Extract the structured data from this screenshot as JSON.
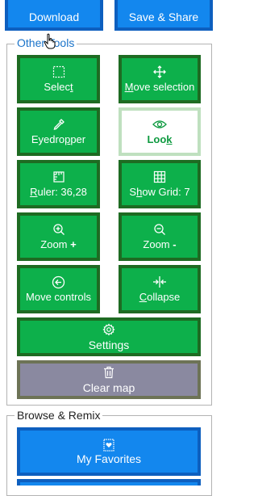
{
  "top": {
    "download_label": "Download",
    "save_share_label": "Save & Share"
  },
  "other_tools": {
    "legend": "Other Tools",
    "buttons": [
      {
        "pre": "Selec",
        "ul": "t",
        "post": ""
      },
      {
        "pre": "",
        "ul": "M",
        "post": "ove selection"
      },
      {
        "pre": "Eyedro",
        "ul": "p",
        "post": "per"
      },
      {
        "pre": "Loo",
        "ul": "k",
        "post": ""
      },
      {
        "pre": "",
        "ul": "R",
        "post": "uler: 36,28"
      },
      {
        "pre": "S",
        "ul": "h",
        "post": "ow Grid: 7"
      },
      {
        "pre": "Zoom ",
        "bold": "+",
        "post": ""
      },
      {
        "pre": "Zoom ",
        "bold": "-",
        "post": ""
      },
      {
        "pre": "Move controls",
        "ul": "",
        "post": ""
      },
      {
        "pre": "",
        "ul": "C",
        "post": "ollapse"
      },
      {
        "pre": "Settings",
        "ul": "",
        "post": ""
      },
      {
        "pre": "Clear map",
        "ul": "",
        "post": ""
      }
    ]
  },
  "browse": {
    "legend": "Browse & Remix",
    "favorites_label": "My Favorites"
  },
  "colors": {
    "blue": "#1387ee",
    "green": "#0db04b",
    "green_border": "#1e6b22",
    "gray_button": "#8a89a0"
  },
  "icons": [
    "select-box-icon",
    "move-arrows-icon",
    "eyedropper-icon",
    "eye-icon",
    "ruler-icon",
    "grid-icon",
    "zoom-in-icon",
    "zoom-out-icon",
    "arrow-left-circle-icon",
    "collapse-icon",
    "gear-icon",
    "trash-icon",
    "favorites-icon",
    "cursor-icon"
  ]
}
